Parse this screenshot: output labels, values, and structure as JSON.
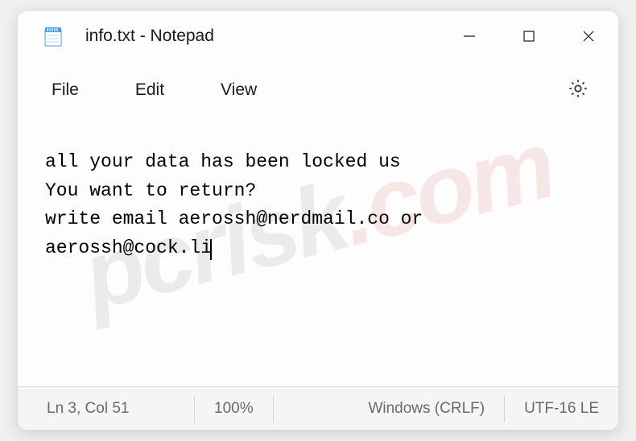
{
  "titlebar": {
    "title": "info.txt - Notepad"
  },
  "menu": {
    "file": "File",
    "edit": "Edit",
    "view": "View"
  },
  "content": {
    "line1": "all your data has been locked us",
    "line2": "You want to return?",
    "line3": "write email aerossh@nerdmail.co or",
    "line4": "aerossh@cock.li"
  },
  "statusbar": {
    "position": "Ln 3, Col 51",
    "zoom": "100%",
    "line_ending": "Windows (CRLF)",
    "encoding": "UTF-16 LE"
  },
  "watermark": {
    "text_a": "pcrisk",
    "text_b": ".com"
  }
}
